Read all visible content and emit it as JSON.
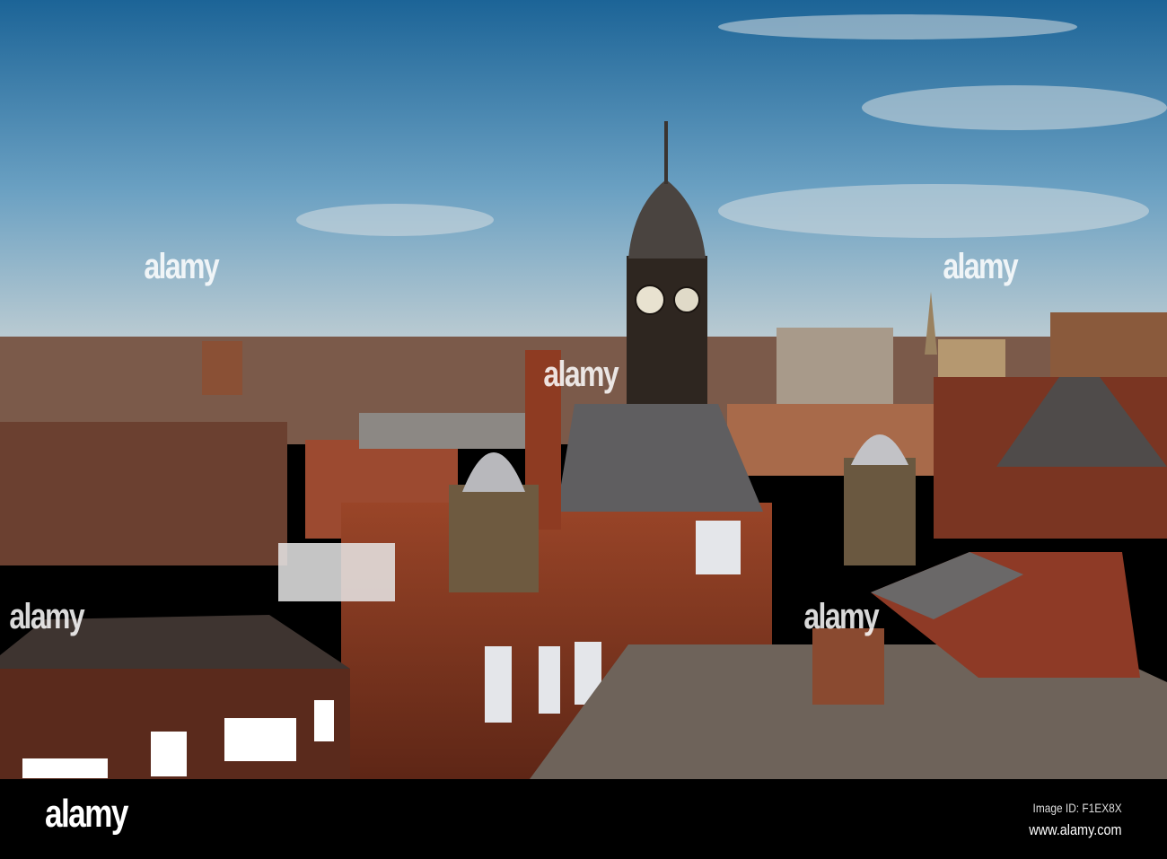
{
  "photo": {
    "subject": "city-rooftops-clock-tower",
    "colors": {
      "sky_top": "#1f6aa0",
      "sky_bottom": "#c9d3d6",
      "brick": "#8a3b22",
      "roof": "#5e5650",
      "tower": "#2e2620"
    }
  },
  "watermark": {
    "text": "alamy"
  },
  "footer": {
    "logo": "alamy",
    "image_id": "Image ID: F1EX8X",
    "website": "www.alamy.com"
  }
}
